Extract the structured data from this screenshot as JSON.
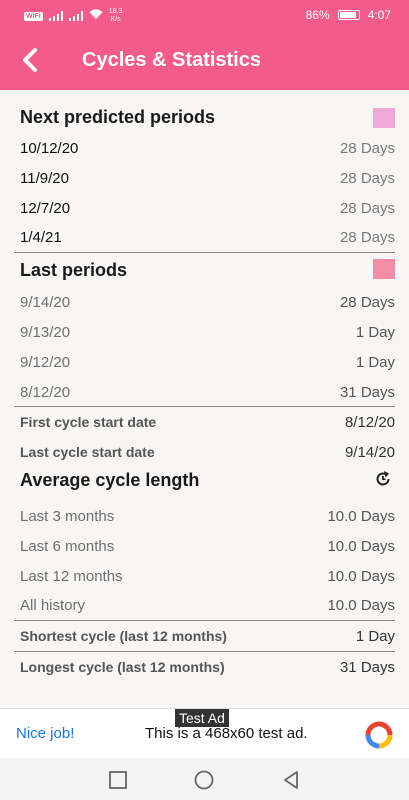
{
  "status_bar": {
    "wifi_badge": "WiFi",
    "speed_value": "18.3",
    "speed_unit": "K/s",
    "battery_percent": "86%",
    "time": "4:07"
  },
  "app_bar": {
    "title": "Cycles & Statistics",
    "color": "#f25b8a"
  },
  "next_predicted": {
    "title": "Next predicted periods",
    "swatch_color": "#f0a8d8",
    "items": [
      {
        "date": "10/12/20",
        "length": "28 Days"
      },
      {
        "date": "11/9/20",
        "length": "28 Days"
      },
      {
        "date": "12/7/20",
        "length": "28 Days"
      },
      {
        "date": "1/4/21",
        "length": "28 Days"
      }
    ]
  },
  "last_periods": {
    "title": "Last periods",
    "swatch_color": "#f48ca6",
    "items": [
      {
        "date": "9/14/20",
        "length": "28 Days"
      },
      {
        "date": "9/13/20",
        "length": "1 Day"
      },
      {
        "date": "9/12/20",
        "length": "1 Day"
      },
      {
        "date": "8/12/20",
        "length": "31 Days"
      }
    ],
    "first_label": "First cycle start date",
    "first_value": "8/12/20",
    "last_label": "Last cycle start date",
    "last_value": "9/14/20"
  },
  "average": {
    "title": "Average cycle length",
    "icon": "refresh-icon",
    "items": [
      {
        "label": "Last 3 months",
        "value": "10.0 Days"
      },
      {
        "label": "Last 6 months",
        "value": "10.0 Days"
      },
      {
        "label": "Last 12 months",
        "value": "10.0 Days"
      },
      {
        "label": "All history",
        "value": "10.0 Days"
      }
    ],
    "shortest_label": "Shortest cycle (last 12 months)",
    "shortest_value": "1 Day",
    "longest_label": "Longest cycle (last 12 months)",
    "longest_value": "31 Days"
  },
  "ad": {
    "tag": "Test Ad",
    "nice": "Nice job!",
    "text": "This is a 468x60 test ad."
  }
}
